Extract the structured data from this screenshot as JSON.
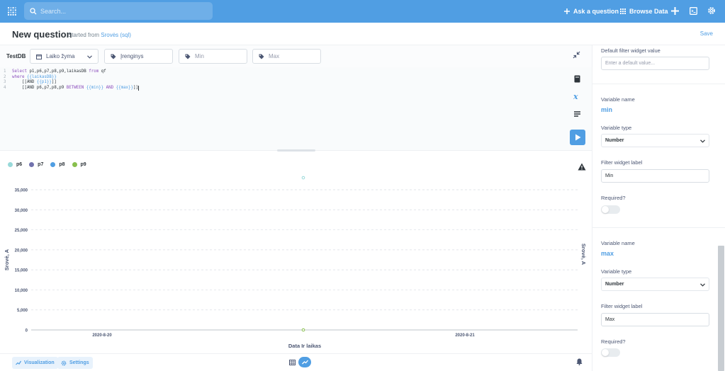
{
  "topbar": {
    "search_placeholder": "Search...",
    "ask_label": "Ask a question",
    "browse_label": "Browse Data"
  },
  "header": {
    "title": "New question",
    "subtitle_prefix": "Started from",
    "subtitle_source": "Srovės (sql)",
    "save_label": "Save"
  },
  "filters": {
    "database": "TestDB",
    "date_filter": "Laiko žyma",
    "device_filter": "Įrenginys",
    "min_placeholder": "Min",
    "max_placeholder": "Max"
  },
  "editor": {
    "lines": [
      {
        "n": "1",
        "parts": [
          [
            "kw",
            "Select"
          ],
          [
            "txt",
            " p1,p6,p7,p8,p9,laikasDB "
          ],
          [
            "kw",
            "from"
          ],
          [
            "txt",
            " qf"
          ]
        ]
      },
      {
        "n": "2",
        "parts": [
          [
            "kw",
            "where"
          ],
          [
            "kw2",
            " {{laikasDB}}"
          ]
        ]
      },
      {
        "n": "3",
        "parts": [
          [
            "txt",
            "    [[AND "
          ],
          [
            "kw2",
            "{{p1}}"
          ],
          [
            "txt",
            "]]"
          ]
        ]
      },
      {
        "n": "4",
        "parts": [
          [
            "txt",
            "    [[AND p6,p7,p8,p9 "
          ],
          [
            "kw",
            "BETWEEN"
          ],
          [
            "kw2",
            " {{min}}"
          ],
          [
            "kw",
            " AND"
          ],
          [
            "kw2",
            " {{max}}"
          ],
          [
            "txt",
            "]]"
          ]
        ]
      }
    ]
  },
  "legend": [
    {
      "name": "p6",
      "color": "#88bf4d"
    },
    {
      "name": "p7",
      "color": "#7172ad"
    },
    {
      "name": "p8",
      "color": "#509ee3"
    },
    {
      "name": "p9",
      "color": "#88bf4d"
    }
  ],
  "chart_data": {
    "type": "scatter",
    "xlabel": "Data Ir laikas",
    "ylabel": "Srovė, A",
    "y2label": "Srovė, A",
    "ylim": [
      0,
      35000
    ],
    "yticks": [
      "0",
      "5,000",
      "10,000",
      "15,000",
      "20,000",
      "25,000",
      "30,000",
      "35,000"
    ],
    "xticks": [
      "2020-8-20",
      "2020-8-21"
    ],
    "grid": true,
    "legend_position": "top-left",
    "series": [
      {
        "name": "p6",
        "color": "#98d9d9",
        "points": [
          {
            "x": "2020-8-20 12:00",
            "y": 38000
          }
        ]
      },
      {
        "name": "p9",
        "color": "#88bf4d",
        "points": [
          {
            "x": "2020-8-20 12:00",
            "y": 0
          }
        ]
      }
    ]
  },
  "bottom": {
    "visualization_label": "Visualization",
    "settings_label": "Settings"
  },
  "panel": {
    "default_label": "Default filter widget value",
    "default_placeholder": "Enter a default value...",
    "var1": {
      "name_label": "Variable name",
      "name": "min",
      "type_label": "Variable type",
      "type": "Number",
      "widget_label": "Filter widget label",
      "widget_value": "Min",
      "required_label": "Required?"
    },
    "var2": {
      "name_label": "Variable name",
      "name": "max",
      "type_label": "Variable type",
      "type": "Number",
      "widget_label": "Filter widget label",
      "widget_value": "Max",
      "required_label": "Required?"
    }
  }
}
